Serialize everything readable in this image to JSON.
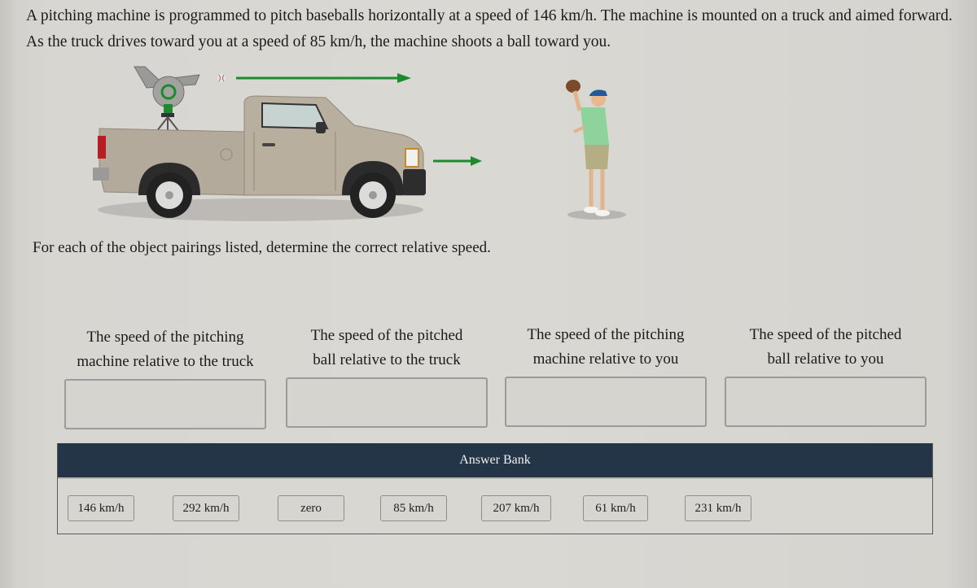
{
  "question": {
    "text": "A pitching machine is programmed to pitch baseballs horizontally at a speed of 146 km/h. The machine is mounted on a truck and aimed forward. As the truck drives toward you at a speed of 85 km/h, the machine shoots a ball toward you."
  },
  "illustration": {
    "description": "Pickup truck with pitching machine on tripod in bed; ball fired forward (green arrow) toward a person wearing a glove; truck moving forward (green arrow)",
    "arrow_color": "#1e8a2e",
    "truck_color": "#b3aa9b"
  },
  "instruction": "For each of the object pairings listed, determine the correct relative speed.",
  "targets": [
    {
      "label_line1": "The speed of the pitching",
      "label_line2": "machine relative to the truck",
      "value": ""
    },
    {
      "label_line1": "The speed of the pitched",
      "label_line2": "ball relative to the truck",
      "value": ""
    },
    {
      "label_line1": "The speed of the pitching",
      "label_line2": "machine relative to you",
      "value": ""
    },
    {
      "label_line1": "The speed of the pitched",
      "label_line2": "ball relative to you",
      "value": ""
    }
  ],
  "answer_bank": {
    "title": "Answer Bank",
    "header_color": "#243548",
    "items": [
      "146 km/h",
      "292 km/h",
      "zero",
      "85 km/h",
      "207 km/h",
      "61 km/h",
      "231 km/h"
    ]
  }
}
